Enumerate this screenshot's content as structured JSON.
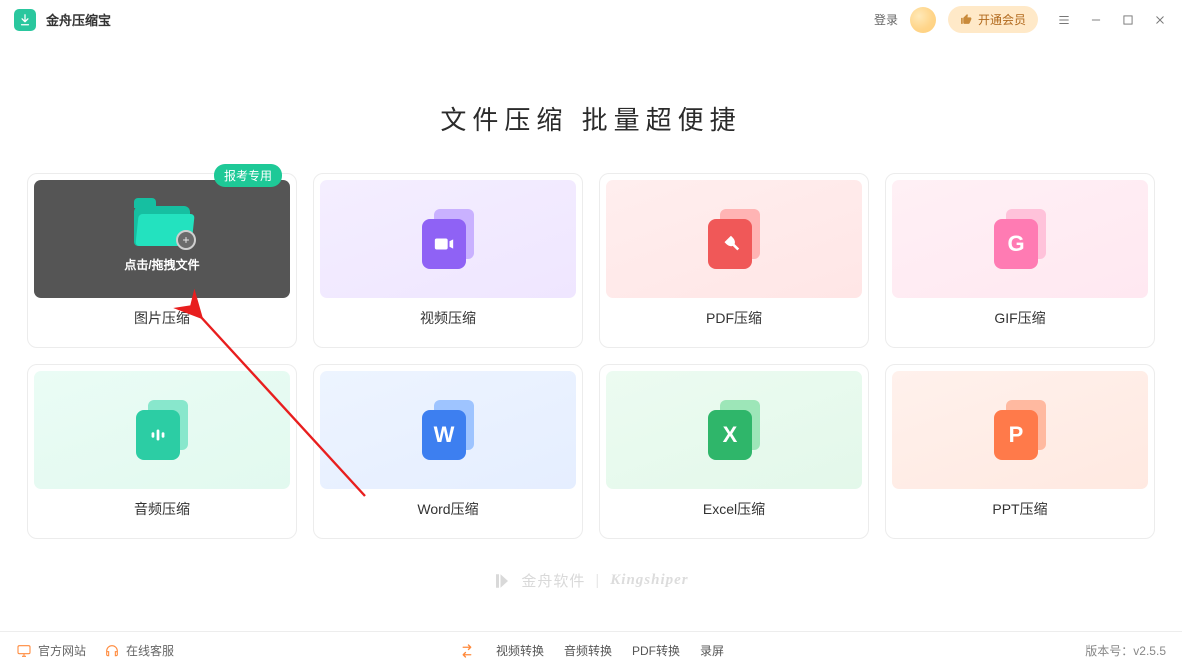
{
  "app": {
    "title": "金舟压缩宝"
  },
  "header": {
    "login": "登录",
    "vip_button": "开通会员"
  },
  "main": {
    "headline": "文件压缩 批量超便捷",
    "cards": {
      "image": {
        "label": "图片压缩",
        "badge": "报考专用",
        "drop_text": "点击/拖拽文件"
      },
      "video": {
        "label": "视频压缩"
      },
      "pdf": {
        "label": "PDF压缩"
      },
      "gif": {
        "label": "GIF压缩"
      },
      "audio": {
        "label": "音频压缩"
      },
      "word": {
        "label": "Word压缩"
      },
      "excel": {
        "label": "Excel压缩"
      },
      "ppt": {
        "label": "PPT压缩"
      }
    }
  },
  "brand": {
    "company": "金舟软件",
    "product_latin": "Kingshiper"
  },
  "bottombar": {
    "official_site": "官方网站",
    "online_service": "在线客服",
    "video_convert": "视频转换",
    "audio_convert": "音频转换",
    "pdf_convert": "PDF转换",
    "screen_record": "录屏",
    "version_label": "版本号：v2.5.5"
  }
}
